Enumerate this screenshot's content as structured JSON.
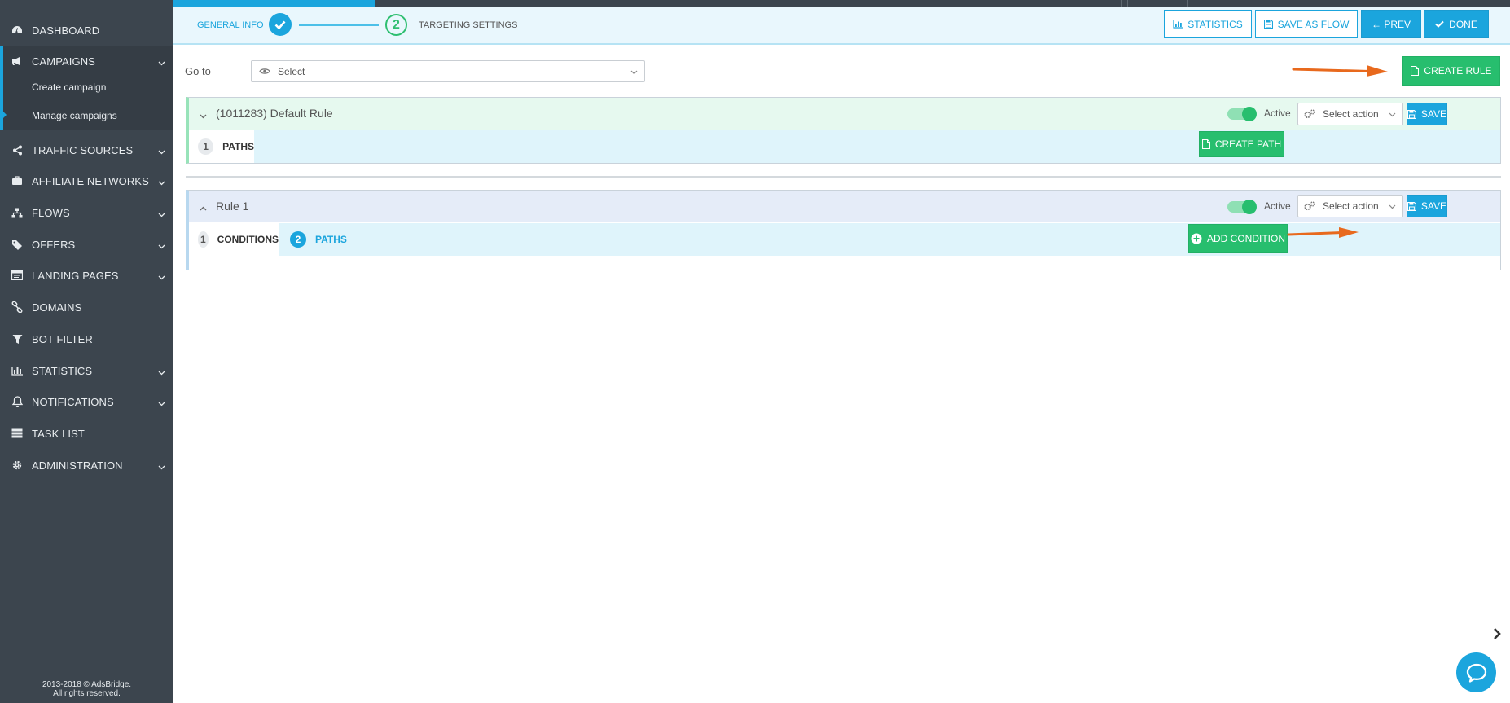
{
  "sidebar": {
    "items": [
      {
        "label": "DASHBOARD",
        "icon": "dashboard-icon"
      },
      {
        "label": "CAMPAIGNS",
        "icon": "megaphone-icon"
      },
      {
        "label": "TRAFFIC SOURCES",
        "icon": "share-icon"
      },
      {
        "label": "AFFILIATE NETWORKS",
        "icon": "briefcase-icon"
      },
      {
        "label": "FLOWS",
        "icon": "sitemap-icon"
      },
      {
        "label": "OFFERS",
        "icon": "tags-icon"
      },
      {
        "label": "LANDING PAGES",
        "icon": "window-icon"
      },
      {
        "label": "DOMAINS",
        "icon": "link-icon"
      },
      {
        "label": "BOT FILTER",
        "icon": "filter-icon"
      },
      {
        "label": "STATISTICS",
        "icon": "bar-chart-icon"
      },
      {
        "label": "NOTIFICATIONS",
        "icon": "bell-icon"
      },
      {
        "label": "TASK LIST",
        "icon": "list-icon"
      },
      {
        "label": "ADMINISTRATION",
        "icon": "gear-icon"
      }
    ],
    "campaigns_sub": [
      "Create campaign",
      "Manage campaigns"
    ],
    "footer_line1": "2013-2018 © AdsBridge.",
    "footer_line2": "All rights reserved."
  },
  "wizard": {
    "step1_label": "GENERAL INFO",
    "step2_number": "2",
    "step2_label": "TARGETING SETTINGS"
  },
  "toolbar": {
    "statistics": "STATISTICS",
    "save_as_flow": "SAVE AS FLOW",
    "prev": "← PREV",
    "done": "DONE"
  },
  "goto": {
    "label": "Go to",
    "value": "Select"
  },
  "create_rule": "CREATE RULE",
  "rules": [
    {
      "title": "(1011283) Default Rule",
      "active_label": "Active",
      "action_select": "Select action",
      "save": "SAVE",
      "tabs": [
        {
          "num": "1",
          "label": "PATHS"
        }
      ],
      "tab_button": "CREATE PATH"
    },
    {
      "title": "Rule 1",
      "active_label": "Active",
      "action_select": "Select action",
      "save": "SAVE",
      "tabs": [
        {
          "num": "1",
          "label": "CONDITIONS"
        },
        {
          "num": "2",
          "label": "PATHS"
        }
      ],
      "tab_button": "ADD CONDITION"
    }
  ],
  "colors": {
    "sidebar_bg": "#3c454e",
    "accent_blue": "#1ba5dd",
    "accent_green": "#27be6e",
    "arrow_orange": "#e8691d"
  }
}
